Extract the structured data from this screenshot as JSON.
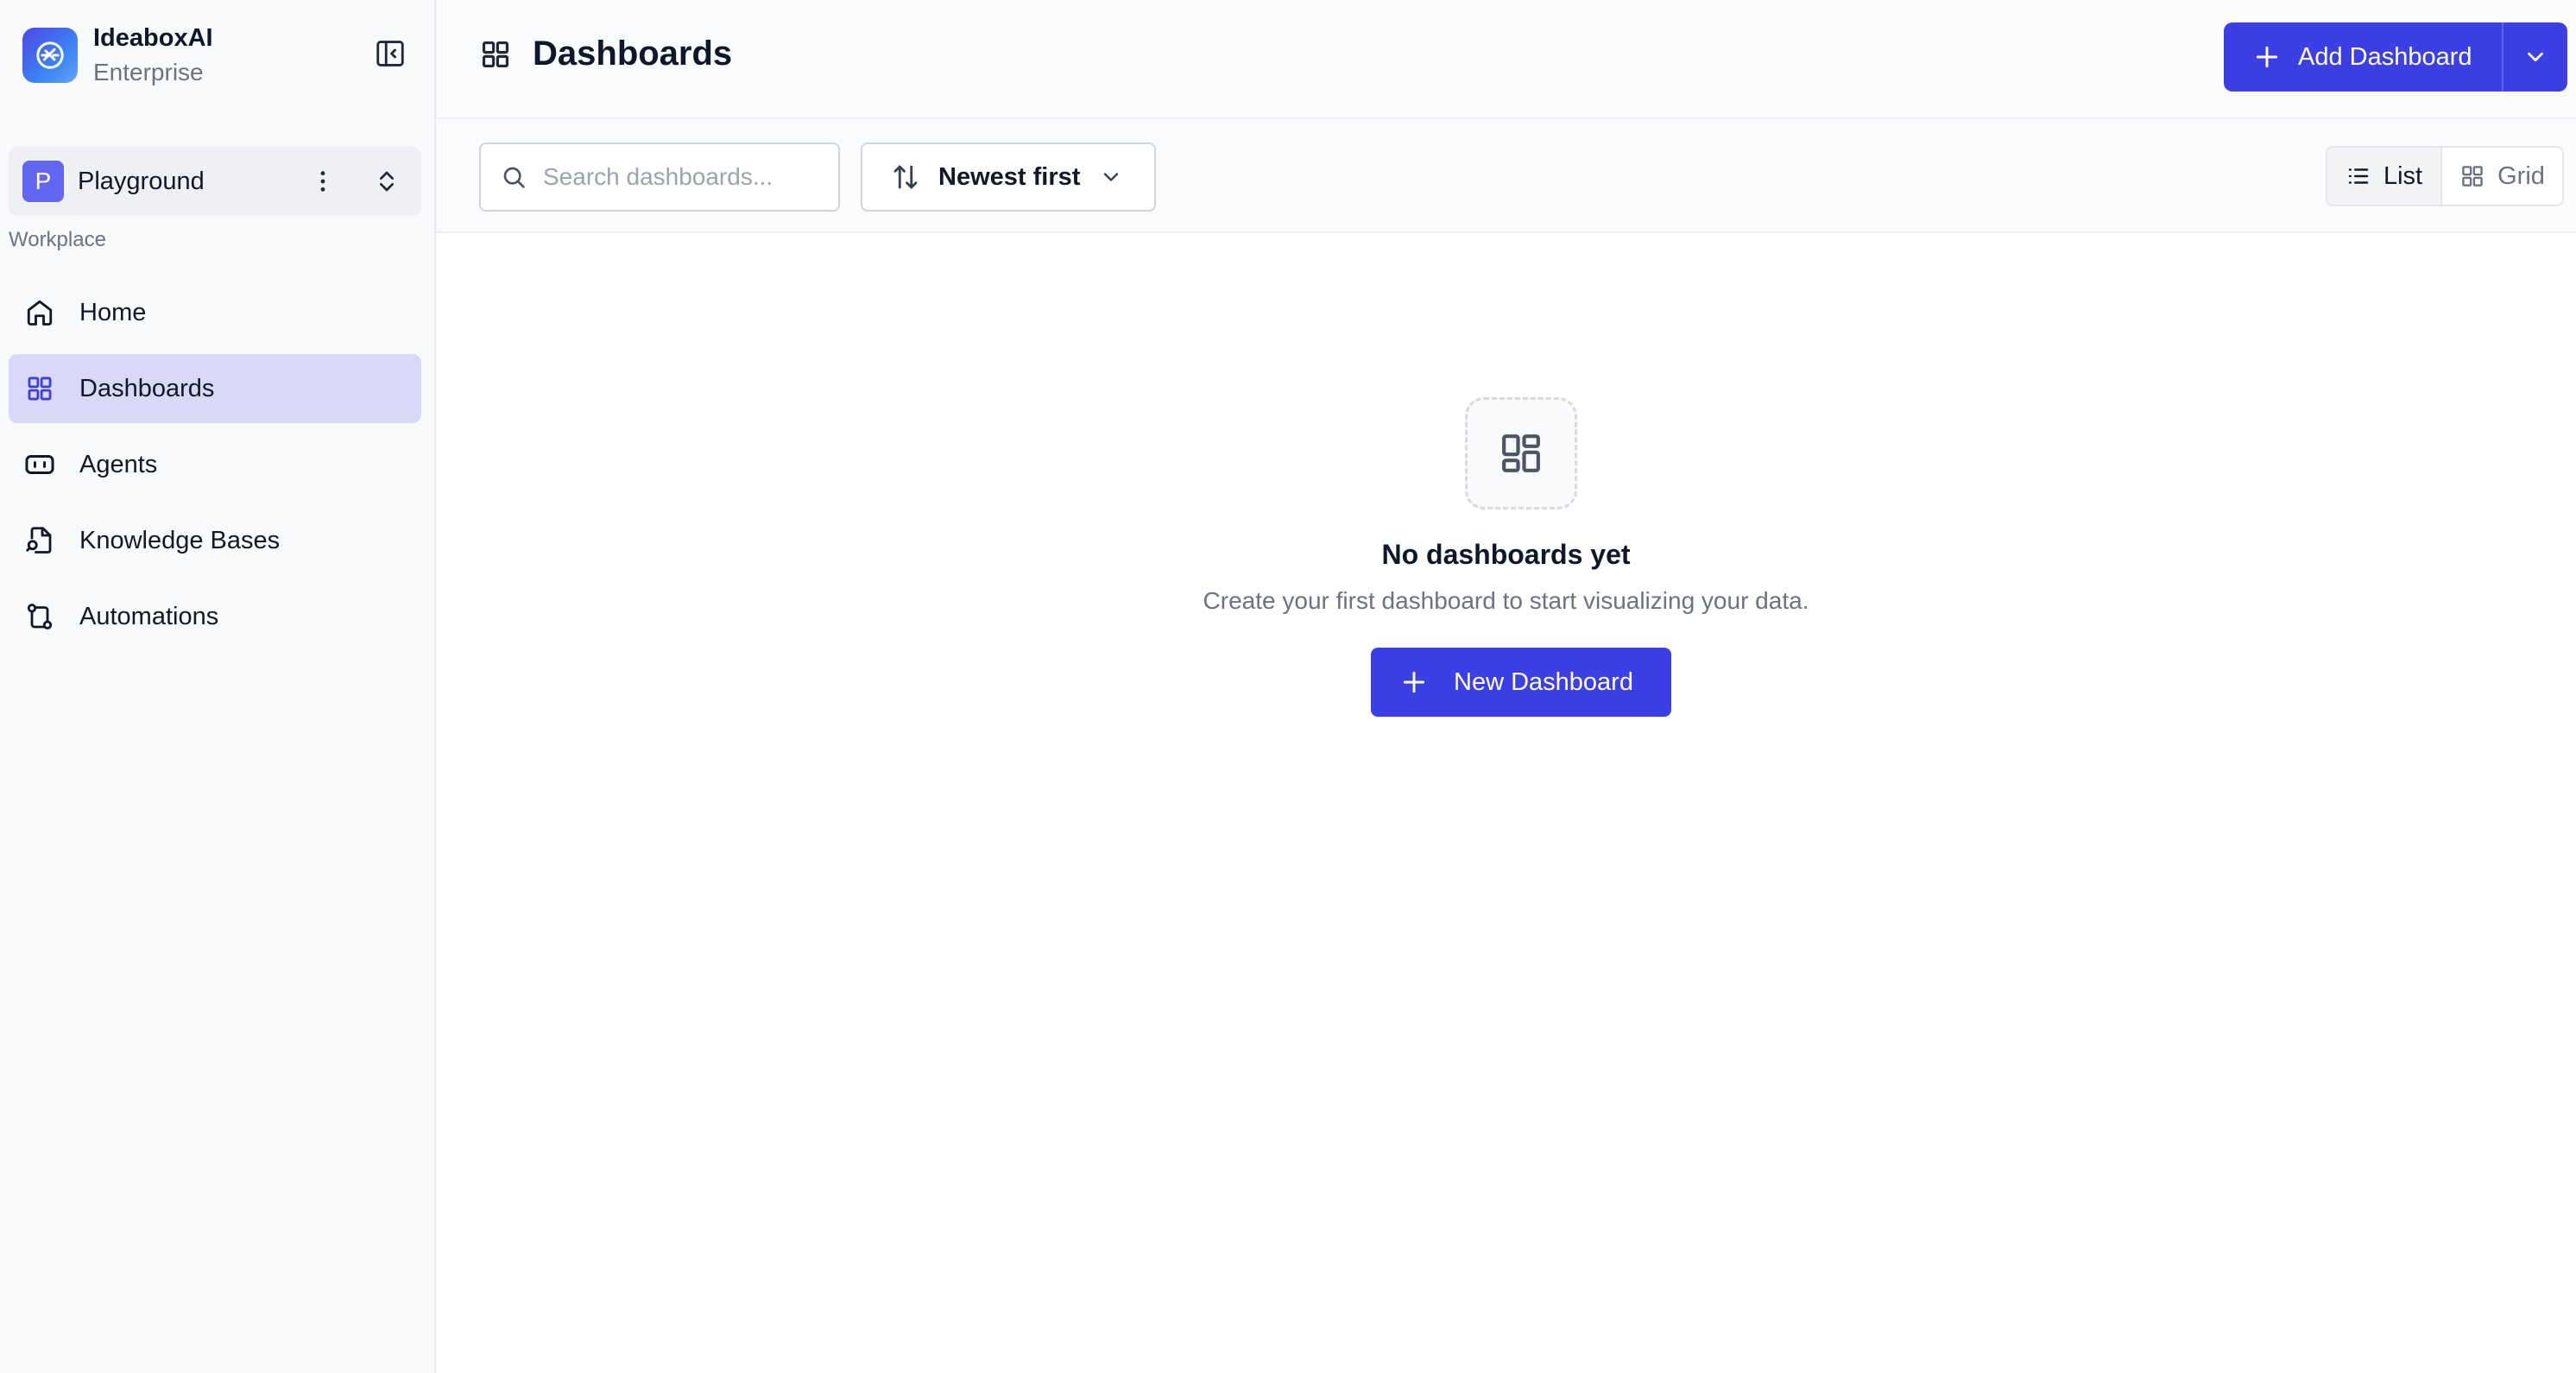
{
  "colors": {
    "accent": "#3b3fe4",
    "active_nav_bg": "#d8d9f7",
    "workspace_avatar": "#6366f1"
  },
  "brand": {
    "name": "IdeaboxAI",
    "plan": "Enterprise",
    "logo_icon": "ideabox-logo-icon"
  },
  "sidebar": {
    "collapse_icon": "panel-collapse-icon",
    "workspace": {
      "avatar_letter": "P",
      "name": "Playground",
      "more_icon": "more-vertical-icon",
      "switch_icon": "chevron-up-down-icon"
    },
    "section_label": "Workplace",
    "items": [
      {
        "label": "Home",
        "icon": "home-icon",
        "active": false
      },
      {
        "label": "Dashboards",
        "icon": "dashboard-grid-icon",
        "active": true
      },
      {
        "label": "Agents",
        "icon": "agent-icon",
        "active": false
      },
      {
        "label": "Knowledge Bases",
        "icon": "file-search-icon",
        "active": false
      },
      {
        "label": "Automations",
        "icon": "workflow-icon",
        "active": false
      }
    ]
  },
  "header": {
    "title": "Dashboards",
    "title_icon": "dashboard-grid-icon",
    "add_button_label": "Add Dashboard",
    "add_dropdown_icon": "chevron-down-icon"
  },
  "toolbar": {
    "search": {
      "placeholder": "Search dashboards...",
      "value": ""
    },
    "sort": {
      "label": "Newest first",
      "icon": "sort-arrows-icon"
    },
    "view": {
      "list_label": "List",
      "grid_label": "Grid",
      "selected": "List"
    }
  },
  "empty_state": {
    "icon": "dashboard-grid-icon",
    "title": "No dashboards yet",
    "description": "Create your first dashboard to start visualizing your data.",
    "button_label": "New Dashboard"
  }
}
